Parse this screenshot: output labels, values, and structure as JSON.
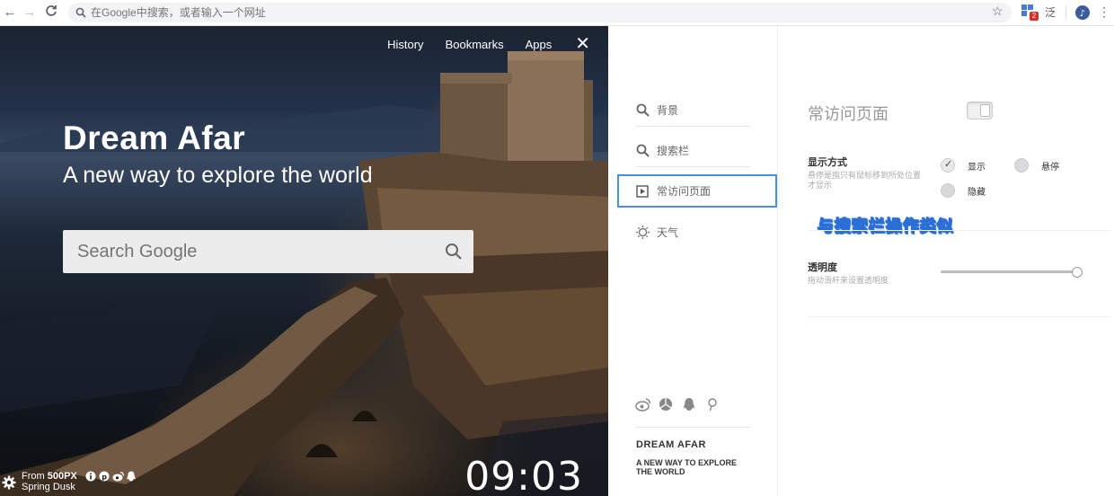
{
  "browser": {
    "omnibox_placeholder": "在Google中搜索，或者输入一个网址",
    "extension_badge": "2"
  },
  "photo": {
    "top_links": [
      "History",
      "Bookmarks",
      "Apps"
    ],
    "hero_title": "Dream Afar",
    "hero_subtitle": "A new way to explore the world",
    "search_placeholder": "Search Google",
    "credit_from": "From ",
    "credit_source": "500PX",
    "credit_title": "Spring Dusk",
    "clock": "09:03"
  },
  "settings_nav": {
    "items": [
      {
        "label": "背景",
        "icon": "search-icon"
      },
      {
        "label": "搜索栏",
        "icon": "search-icon"
      },
      {
        "label": "常访问页面",
        "icon": "play-square-icon",
        "active": true
      },
      {
        "label": "天气",
        "icon": "sun-icon"
      }
    ],
    "social_icons": [
      "weibo-icon",
      "aperture-icon",
      "qq-icon",
      "pin-icon"
    ],
    "brand_title": "DREAM AFAR",
    "brand_subtitle": "A NEW WAY TO EXPLORE THE WORLD"
  },
  "panel": {
    "title": "常访问页面",
    "toggle_on": true,
    "display_mode": {
      "label": "显示方式",
      "description": "悬停是指只有鼠标移到所处位置才显示",
      "options": [
        "显示",
        "悬停",
        "隐藏"
      ],
      "selected": "显示"
    },
    "annotation": "与搜索栏操作类似",
    "opacity": {
      "label": "透明度",
      "description": "拖动滑杆来设置透明度",
      "value": 1.0
    }
  },
  "colors": {
    "active_border": "#4a90e2",
    "annotation": "#2b6fd6"
  }
}
